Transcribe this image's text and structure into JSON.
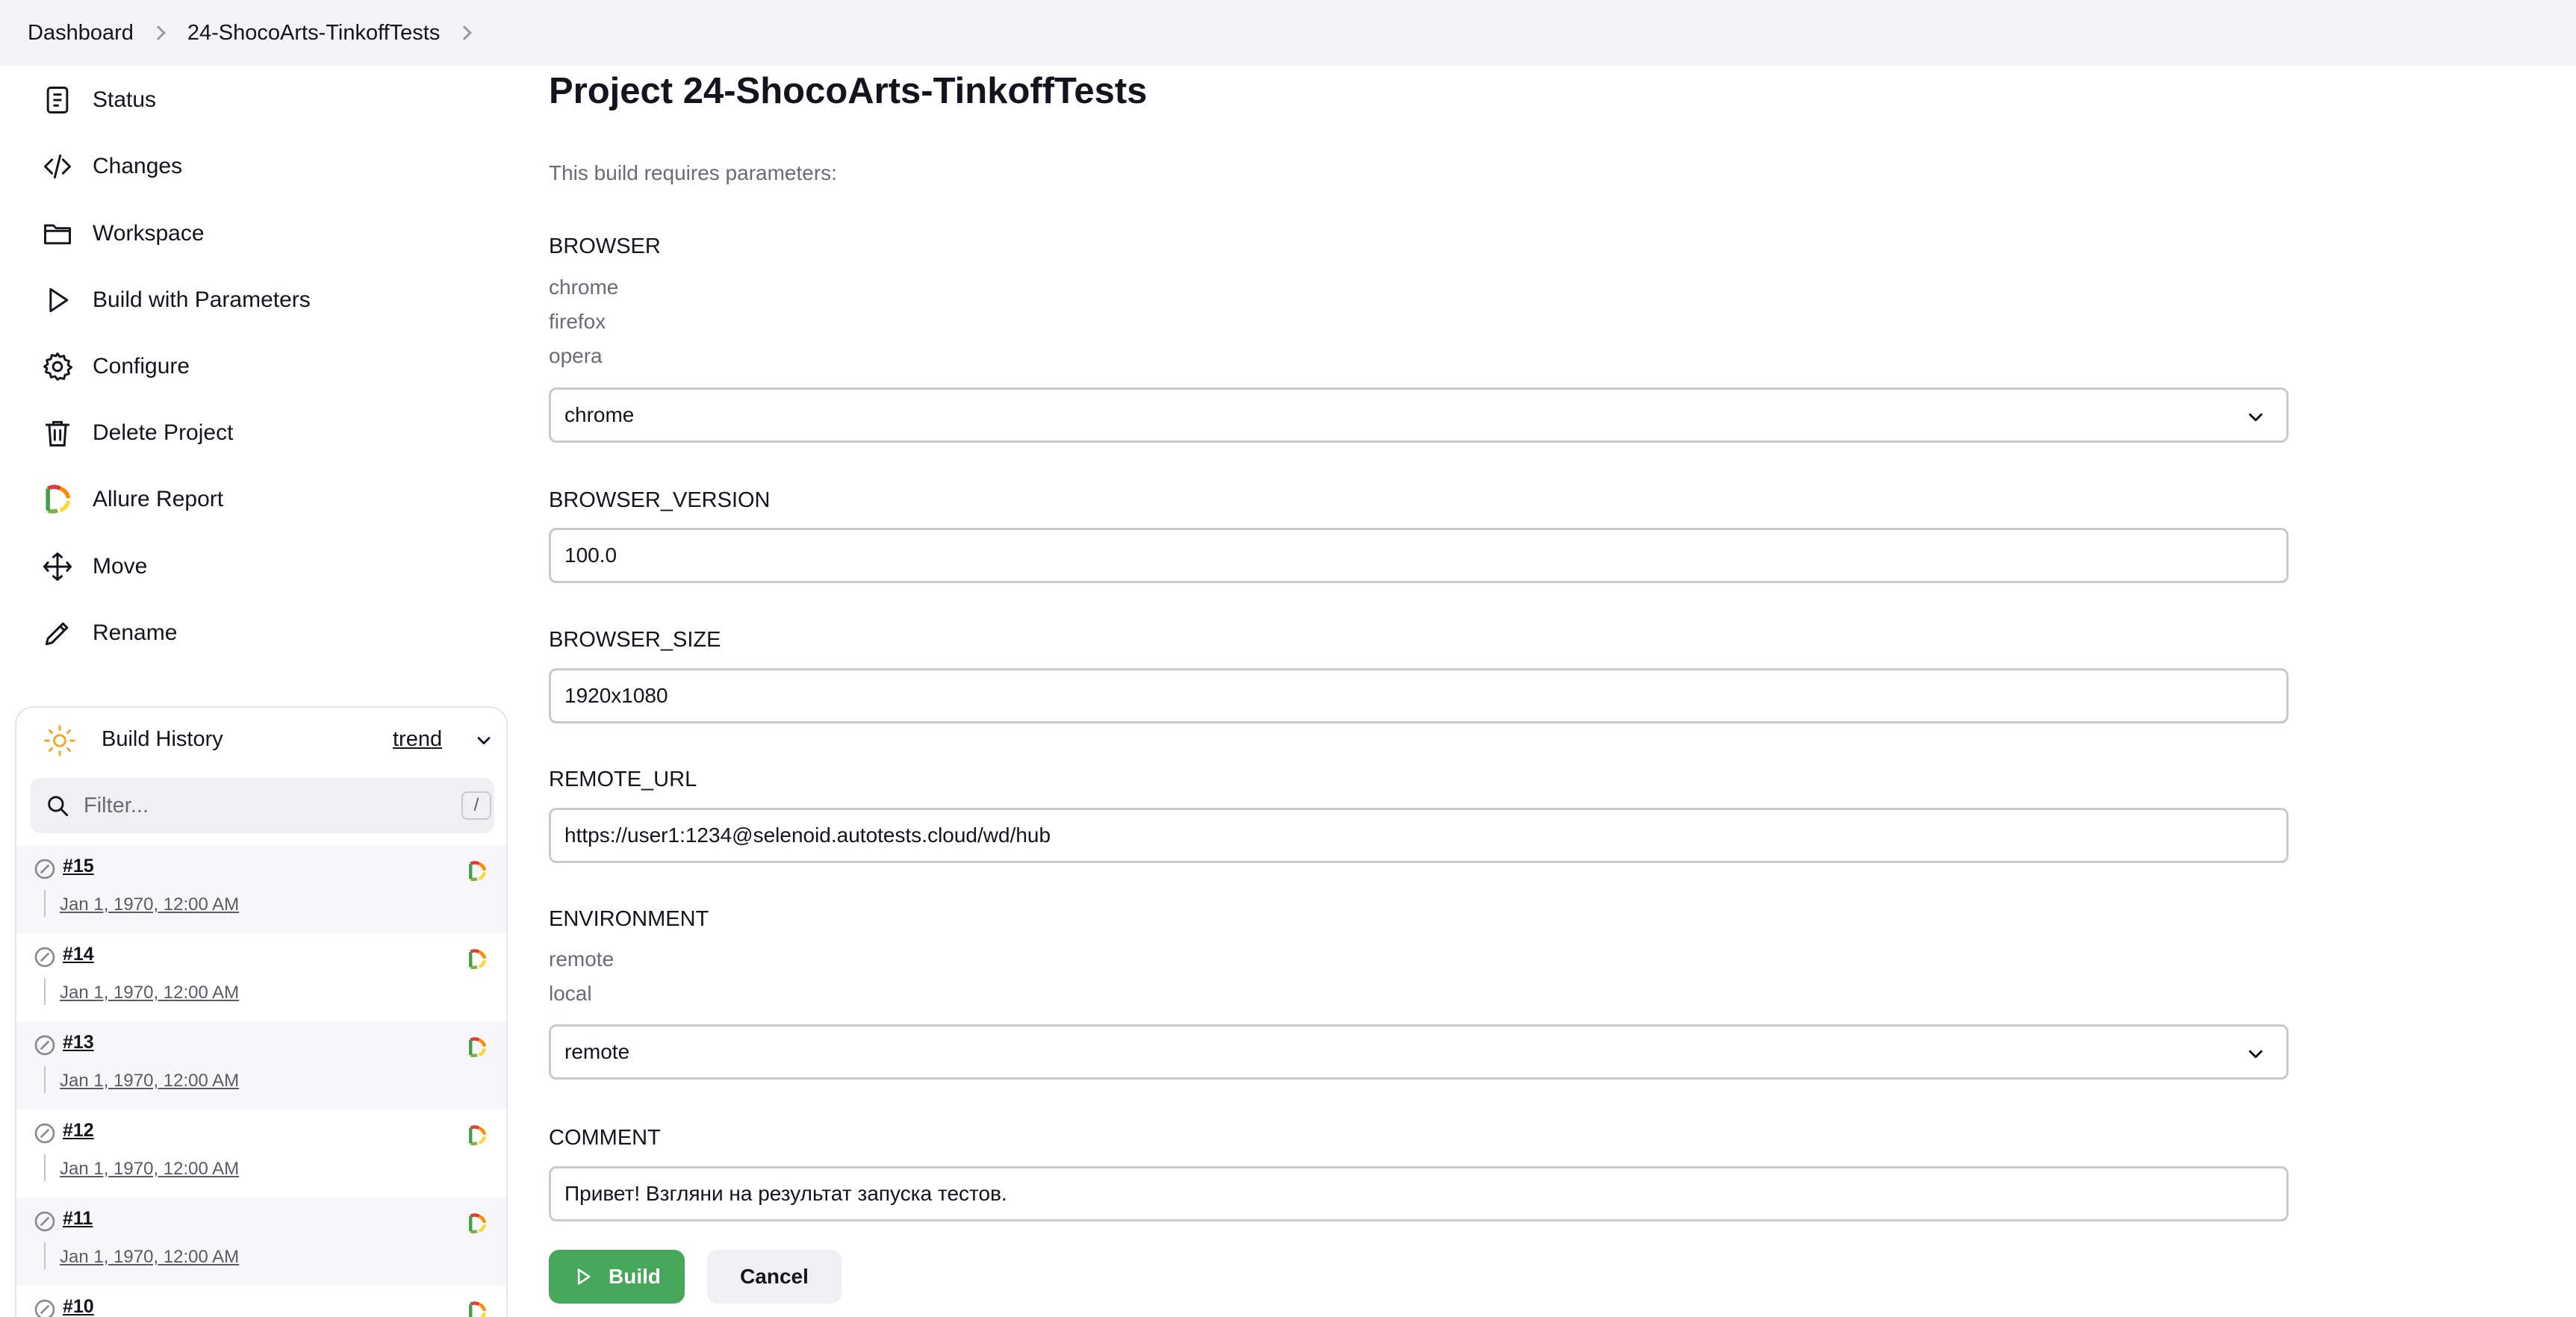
{
  "breadcrumb": [
    {
      "label": "Dashboard"
    },
    {
      "label": "24-ShocoArts-TinkoffTests"
    }
  ],
  "sidebar": {
    "items": [
      {
        "label": "Status",
        "icon": "status-icon"
      },
      {
        "label": "Changes",
        "icon": "code-icon"
      },
      {
        "label": "Workspace",
        "icon": "folder-icon"
      },
      {
        "label": "Build with Parameters",
        "icon": "play-icon"
      },
      {
        "label": "Configure",
        "icon": "gear-icon"
      },
      {
        "label": "Delete Project",
        "icon": "trash-icon"
      },
      {
        "label": "Allure Report",
        "icon": "allure-icon"
      },
      {
        "label": "Move",
        "icon": "move-icon"
      },
      {
        "label": "Rename",
        "icon": "pencil-icon"
      }
    ]
  },
  "build_history": {
    "title": "Build History",
    "trend_label": "trend",
    "filter_placeholder": "Filter...",
    "shortcut": "/",
    "builds": [
      {
        "number": "#15",
        "date": "Jan 1, 1970, 12:00 AM"
      },
      {
        "number": "#14",
        "date": "Jan 1, 1970, 12:00 AM"
      },
      {
        "number": "#13",
        "date": "Jan 1, 1970, 12:00 AM"
      },
      {
        "number": "#12",
        "date": "Jan 1, 1970, 12:00 AM"
      },
      {
        "number": "#11",
        "date": "Jan 1, 1970, 12:00 AM"
      },
      {
        "number": "#10",
        "date": ""
      }
    ]
  },
  "main": {
    "title": "Project 24-ShocoArts-TinkoffTests",
    "intro": "This build requires parameters:",
    "params": {
      "browser": {
        "label": "BROWSER",
        "choices": [
          "chrome",
          "firefox",
          "opera"
        ],
        "value": "chrome"
      },
      "browser_version": {
        "label": "BROWSER_VERSION",
        "value": "100.0"
      },
      "browser_size": {
        "label": "BROWSER_SIZE",
        "value": "1920x1080"
      },
      "remote_url": {
        "label": "REMOTE_URL",
        "value": "https://user1:1234@selenoid.autotests.cloud/wd/hub"
      },
      "environment": {
        "label": "ENVIRONMENT",
        "choices": [
          "remote",
          "local"
        ],
        "value": "remote"
      },
      "comment": {
        "label": "COMMENT",
        "value": "Привет! Взгляни на результат запуска тестов."
      }
    },
    "actions": {
      "build": "Build",
      "cancel": "Cancel"
    }
  },
  "colors": {
    "build_button": "#46a75a",
    "topbar_bg": "#f4f4f6",
    "sun_icon": "#f5a623"
  }
}
